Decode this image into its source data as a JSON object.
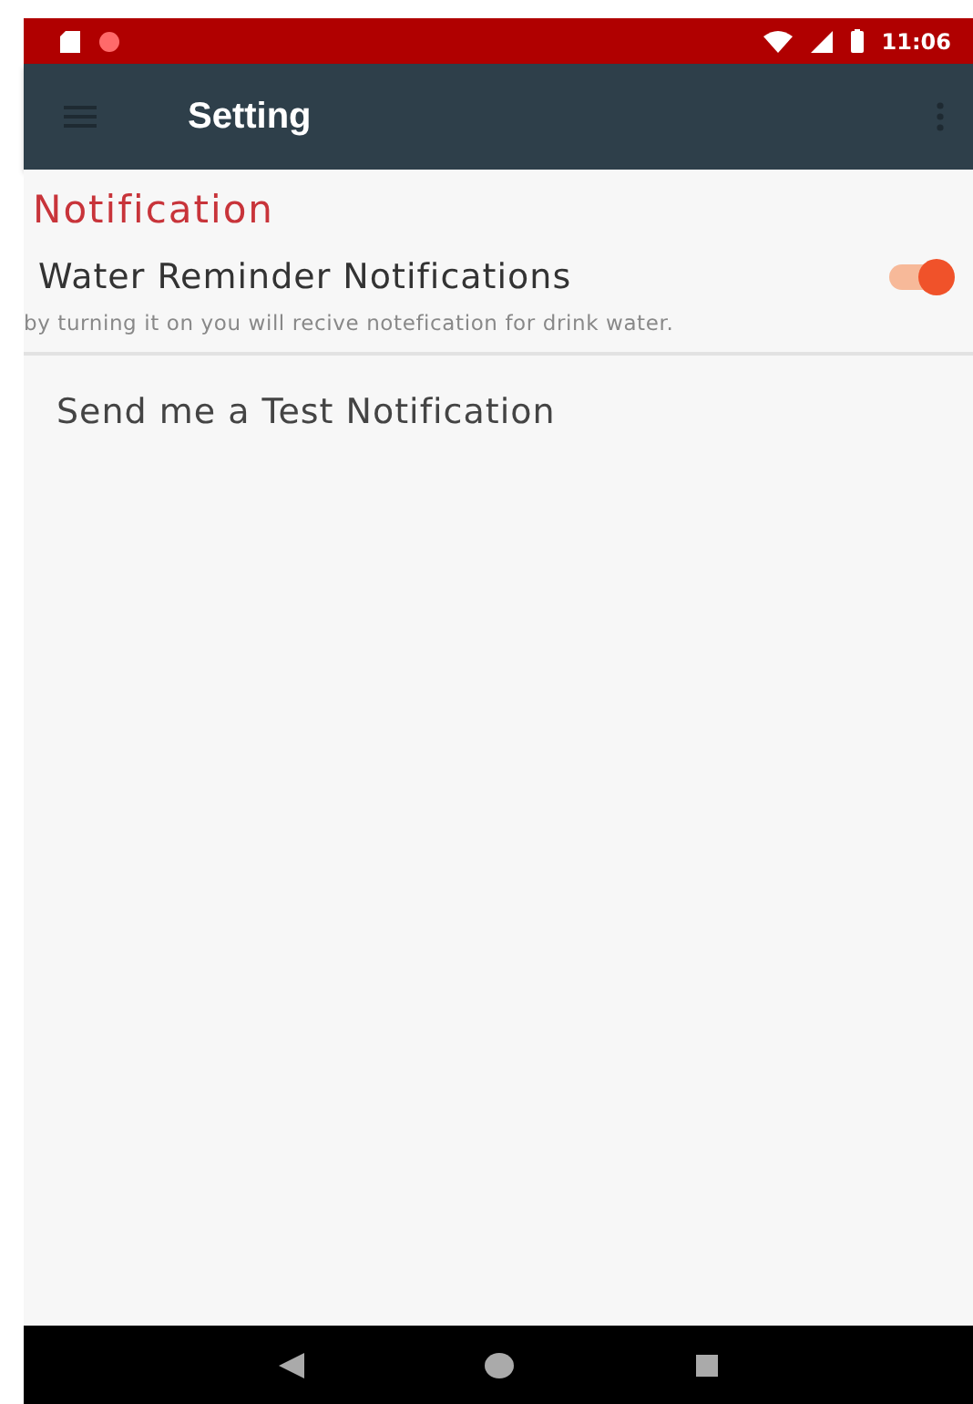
{
  "status_bar": {
    "time": "11:06"
  },
  "app_bar": {
    "title": "Setting"
  },
  "section": {
    "title": "Notification"
  },
  "settings": [
    {
      "kind": "switch",
      "label": "Water Reminder Notifications",
      "on": true,
      "description": "by turning it on you will recive notefication for drink water."
    },
    {
      "kind": "action",
      "label": "Send me a Test Notification"
    }
  ]
}
